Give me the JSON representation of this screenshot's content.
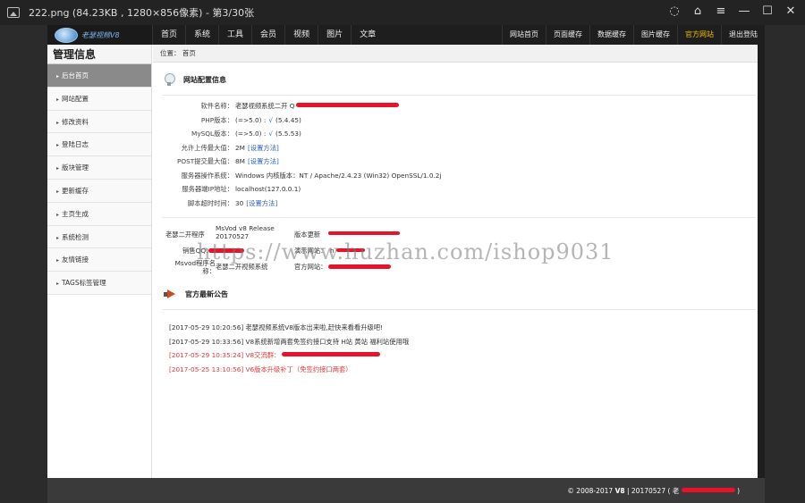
{
  "viewer": {
    "title": "222.png (84.23KB , 1280×856像素) - 第3/30张",
    "controls": [
      "chat-icon",
      "shirt-icon",
      "menu-icon",
      "minimize-icon",
      "maximize-icon",
      "close-icon"
    ]
  },
  "site": {
    "brand": "老瑟视频V8",
    "nav_left": [
      "首页",
      "系统",
      "工具",
      "会员",
      "视频",
      "图片",
      "文章"
    ],
    "nav_right": [
      "网站首页",
      "页面缓存",
      "数据缓存",
      "图片缓存",
      "官方网站",
      "退出登陆"
    ],
    "active_nav_right": "官方网站",
    "sidebar_title": "管理信息",
    "sidebar_items": [
      "后台首页",
      "网站配置",
      "修改资料",
      "登陆日志",
      "版块管理",
      "更新缓存",
      "主页生成",
      "系统检测",
      "友情链接",
      "TAGS标签管理"
    ],
    "breadcrumb": "位置： 首页",
    "config_title": "网站配置信息",
    "config_rows": [
      {
        "label": "软件名称：",
        "value": "老瑟视频系统二开 Q"
      },
      {
        "label": "PHP版本：",
        "value": "(=>5.0) :",
        "check": "√",
        "extra": "(5.4.45)"
      },
      {
        "label": "MySQL版本：",
        "value": "(=>5.0) :",
        "check": "√",
        "extra": "(5.5.53)"
      },
      {
        "label": "允许上传最大值：",
        "value": "2M",
        "link": "[设置方法]"
      },
      {
        "label": "POST提交最大值：",
        "value": "8M",
        "link": "[设置方法]"
      },
      {
        "label": "服务器操作系统：",
        "value": "Windows  内核版本：NT / Apache/2.4.23 (Win32) OpenSSL/1.0.2j"
      },
      {
        "label": "服务器端IP地址：",
        "value": "localhost(127.0.0.1)"
      },
      {
        "label": "脚本超时时间：",
        "value": "30",
        "link": "[设置方法]"
      }
    ],
    "version_block": {
      "prog_label": "老瑟二开程序",
      "prog_value": "MsVod v8 Release 20170527",
      "latest_label": "版本更新",
      "sales_qq_label": "销售QQ：",
      "demo_label": "演示网站：",
      "demo_value": "h",
      "name_label": "Msvod程序名称：",
      "name_value": "老瑟二开视频系统",
      "official_label": "官方网站："
    },
    "news_title": "官方最新公告",
    "news": [
      {
        "text": "[2017-05-29 10:20:56] 老瑟视频系统V8版本出来啦,赶快来看看升级吧!",
        "red": false
      },
      {
        "text": "[2017-05-29 10:33:56] V8系统新增两套免签约接口支持 H站 黄站 福利站使用哦",
        "red": false
      },
      {
        "text": "[2017-05-29 10:35:24] V8交流群：",
        "red": true
      },
      {
        "text": "[2017-05-25 13:10:56] V6版本升级补丁（免签约接口两套）",
        "red": true
      }
    ],
    "footer": {
      "prefix": "© 2008-2017",
      "bold": "V8",
      "suffix": "| 20170527 ( 老",
      "end": ")"
    }
  },
  "watermark": "https://www.huzhan.com/ishop9031",
  "colors": {
    "active_nav": "#f3c000",
    "scribble": "#e8122b",
    "link": "#2b5fc2"
  }
}
